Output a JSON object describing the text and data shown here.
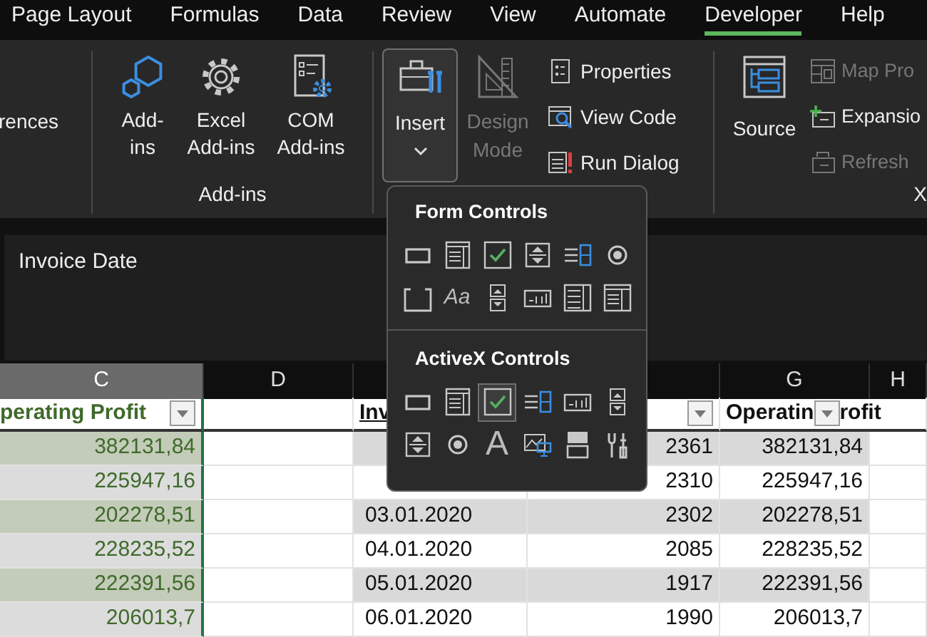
{
  "tabs": [
    {
      "label": "Page Layout",
      "selected": false
    },
    {
      "label": "Formulas",
      "selected": false
    },
    {
      "label": "Data",
      "selected": false
    },
    {
      "label": "Review",
      "selected": false
    },
    {
      "label": "View",
      "selected": false
    },
    {
      "label": "Automate",
      "selected": false
    },
    {
      "label": "Developer",
      "selected": true
    },
    {
      "label": "Help",
      "selected": false
    }
  ],
  "ribbon": {
    "cut_button_label": "rences",
    "addins": {
      "label": "Add-ins",
      "buttons": [
        {
          "label": "Add-ins"
        },
        {
          "label": "Excel Add-ins"
        },
        {
          "label": "COM Add-ins"
        }
      ]
    },
    "controls": {
      "insert": {
        "label": "Insert",
        "pressed": true
      },
      "design_mode": {
        "label": "Design Mode",
        "disabled": true
      },
      "small_buttons": [
        {
          "label": "Properties",
          "disabled": false
        },
        {
          "label": "View Code",
          "disabled": false
        },
        {
          "label": "Run Dialog",
          "disabled": false
        }
      ]
    },
    "xml": {
      "source": {
        "label": "Source"
      },
      "label": "X",
      "small_buttons": [
        {
          "label": "Map Pro",
          "disabled": true
        },
        {
          "label": "Expansio",
          "disabled": false
        },
        {
          "label": "Refresh",
          "disabled": true
        }
      ]
    }
  },
  "formula_bar": {
    "value": "Invoice Date"
  },
  "insert_menu": {
    "form_title": "Form Controls",
    "form_controls": [
      {
        "kind": "command-button",
        "highlighted": false
      },
      {
        "kind": "combo-box",
        "highlighted": false
      },
      {
        "kind": "check-box",
        "highlighted": false
      },
      {
        "kind": "spin-button",
        "highlighted": false
      },
      {
        "kind": "list-box",
        "highlighted": false
      },
      {
        "kind": "option-button",
        "highlighted": false
      },
      {
        "kind": "group-box",
        "highlighted": false
      },
      {
        "kind": "label",
        "glyph": "Aa",
        "highlighted": false
      },
      {
        "kind": "scroll-bar",
        "highlighted": false
      },
      {
        "kind": "text-box",
        "highlighted": false
      },
      {
        "kind": "combo-list",
        "highlighted": false
      },
      {
        "kind": "combo-drop",
        "highlighted": false
      }
    ],
    "activex_title": "ActiveX Controls",
    "activex_controls": [
      {
        "kind": "command-button",
        "highlighted": false
      },
      {
        "kind": "combo-box",
        "highlighted": false
      },
      {
        "kind": "check-box",
        "highlighted": true
      },
      {
        "kind": "list-box",
        "highlighted": false
      },
      {
        "kind": "text-box",
        "highlighted": false
      },
      {
        "kind": "scroll-bar",
        "highlighted": false
      },
      {
        "kind": "spin-button",
        "highlighted": false
      },
      {
        "kind": "option-button",
        "highlighted": false
      },
      {
        "kind": "label",
        "glyph": "A",
        "highlighted": false
      },
      {
        "kind": "image",
        "highlighted": false
      },
      {
        "kind": "toggle-button",
        "highlighted": false
      },
      {
        "kind": "more-controls",
        "highlighted": false
      }
    ]
  },
  "sheet": {
    "columns": [
      {
        "letter": "C",
        "selected": true
      },
      {
        "selected": false,
        "letter": "D"
      },
      {
        "selected": false
      },
      {
        "selected": false
      },
      {
        "letter": "G",
        "selected": false
      },
      {
        "letter": "H",
        "selected": false
      }
    ],
    "header_row": [
      {
        "text": "perating Profit",
        "filter": true
      },
      {
        "filter": false
      },
      {
        "text": "Inv",
        "filter": false
      },
      {
        "filter": true
      },
      {
        "text": "Operatin",
        "text_after": "rofit",
        "filter": true
      }
    ],
    "rows": [
      {
        "cells": [
          "382131,84",
          null,
          null,
          "2361",
          "382131,84",
          null
        ]
      },
      {
        "cells": [
          "225947,16",
          null,
          null,
          "2310",
          "225947,16",
          null
        ]
      },
      {
        "cells": [
          "202278,51",
          null,
          "03.01.2020",
          "2302",
          "202278,51",
          null
        ]
      },
      {
        "cells": [
          "228235,52",
          null,
          "04.01.2020",
          "2085",
          "228235,52",
          null
        ]
      },
      {
        "cells": [
          "222391,56",
          null,
          "05.01.2020",
          "1917",
          "222391,56",
          null
        ]
      },
      {
        "cells": [
          "206013,7",
          null,
          "06.01.2020",
          "1990",
          "206013,7",
          null
        ]
      }
    ]
  }
}
